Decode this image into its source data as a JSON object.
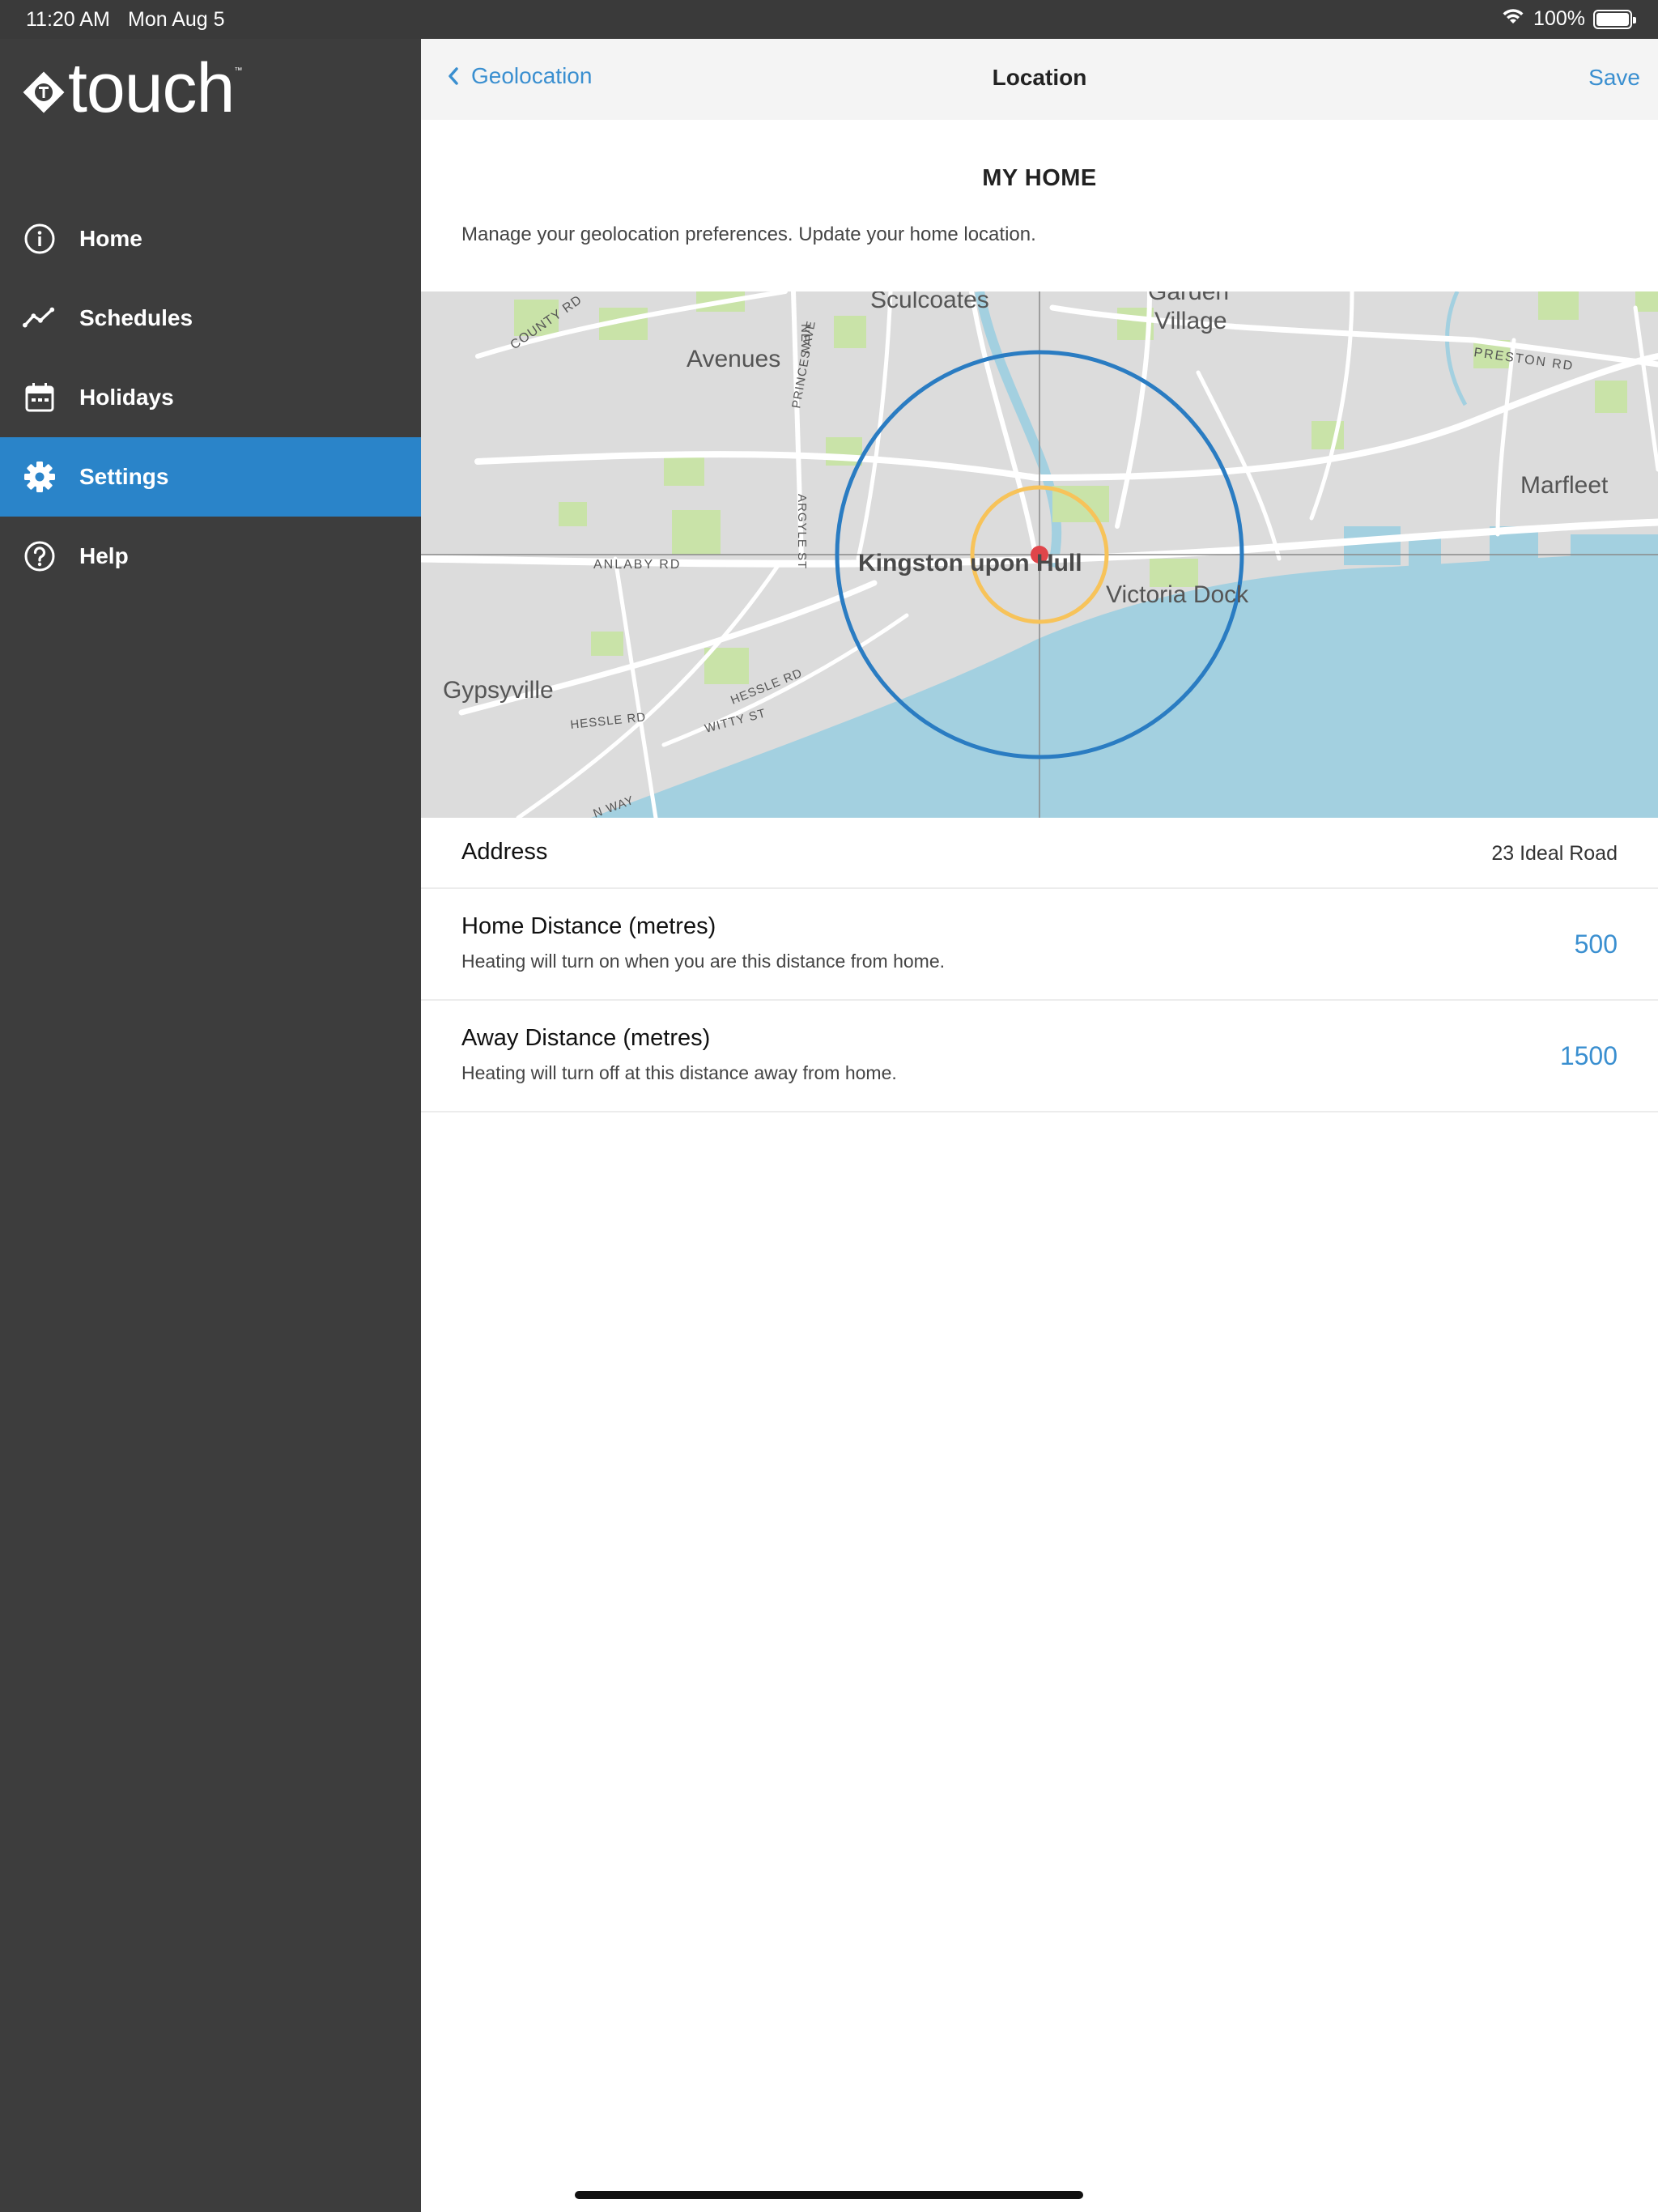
{
  "status_bar": {
    "time": "11:20 AM",
    "date": "Mon Aug 5",
    "battery": "100%",
    "battery_level": 1.0,
    "icons": [
      "wifi-icon",
      "battery-icon"
    ]
  },
  "brand": {
    "name": "touch",
    "tm": "™"
  },
  "sidebar": {
    "items": [
      {
        "label": "Home",
        "icon": "info-icon",
        "active": false
      },
      {
        "label": "Schedules",
        "icon": "trend-line-icon",
        "active": false
      },
      {
        "label": "Holidays",
        "icon": "calendar-icon",
        "active": false
      },
      {
        "label": "Settings",
        "icon": "gear-icon",
        "active": true
      },
      {
        "label": "Help",
        "icon": "question-icon",
        "active": false
      }
    ]
  },
  "header": {
    "back_label": "Geolocation",
    "title": "Location",
    "save_label": "Save"
  },
  "content": {
    "section_title": "MY HOME",
    "description": "Manage your geolocation preferences. Update your home location."
  },
  "map": {
    "labels": {
      "sculcoates": "Sculcoates",
      "garden": "Garden",
      "village": "Village",
      "avenues": "Avenues",
      "preston_rd": "PRESTON RD",
      "marfleet": "Marfleet",
      "county_rd": "COUNTY RD",
      "princes_ave": "PRINCES AVE",
      "new": "NEW",
      "argyle_st": "ARGYLE ST",
      "anlaby_rd": "ANLABY RD",
      "city": "Kingston upon Hull",
      "victoria_dock": "Victoria Dock",
      "gypsyville": "Gypsyville",
      "hessle_rd_1": "HESSLE RD",
      "hessle_rd_2": "HESSLE RD",
      "witty_st": "WITTY ST",
      "way": "N WAY"
    },
    "colors": {
      "land": "#dcdcdc",
      "water": "#a3d0e0",
      "park": "#c9e3a8",
      "road": "#ffffff",
      "home_radius": "#f7c35a",
      "away_radius": "#2a7cc2",
      "pin": "#e0454a"
    }
  },
  "settings": {
    "address": {
      "label": "Address",
      "value": "23 Ideal Road"
    },
    "home_distance": {
      "label": "Home Distance (metres)",
      "sub": "Heating will turn on when you are this distance from home.",
      "value": "500"
    },
    "away_distance": {
      "label": "Away Distance (metres)",
      "sub": "Heating will turn off at this distance away from home.",
      "value": "1500"
    }
  }
}
